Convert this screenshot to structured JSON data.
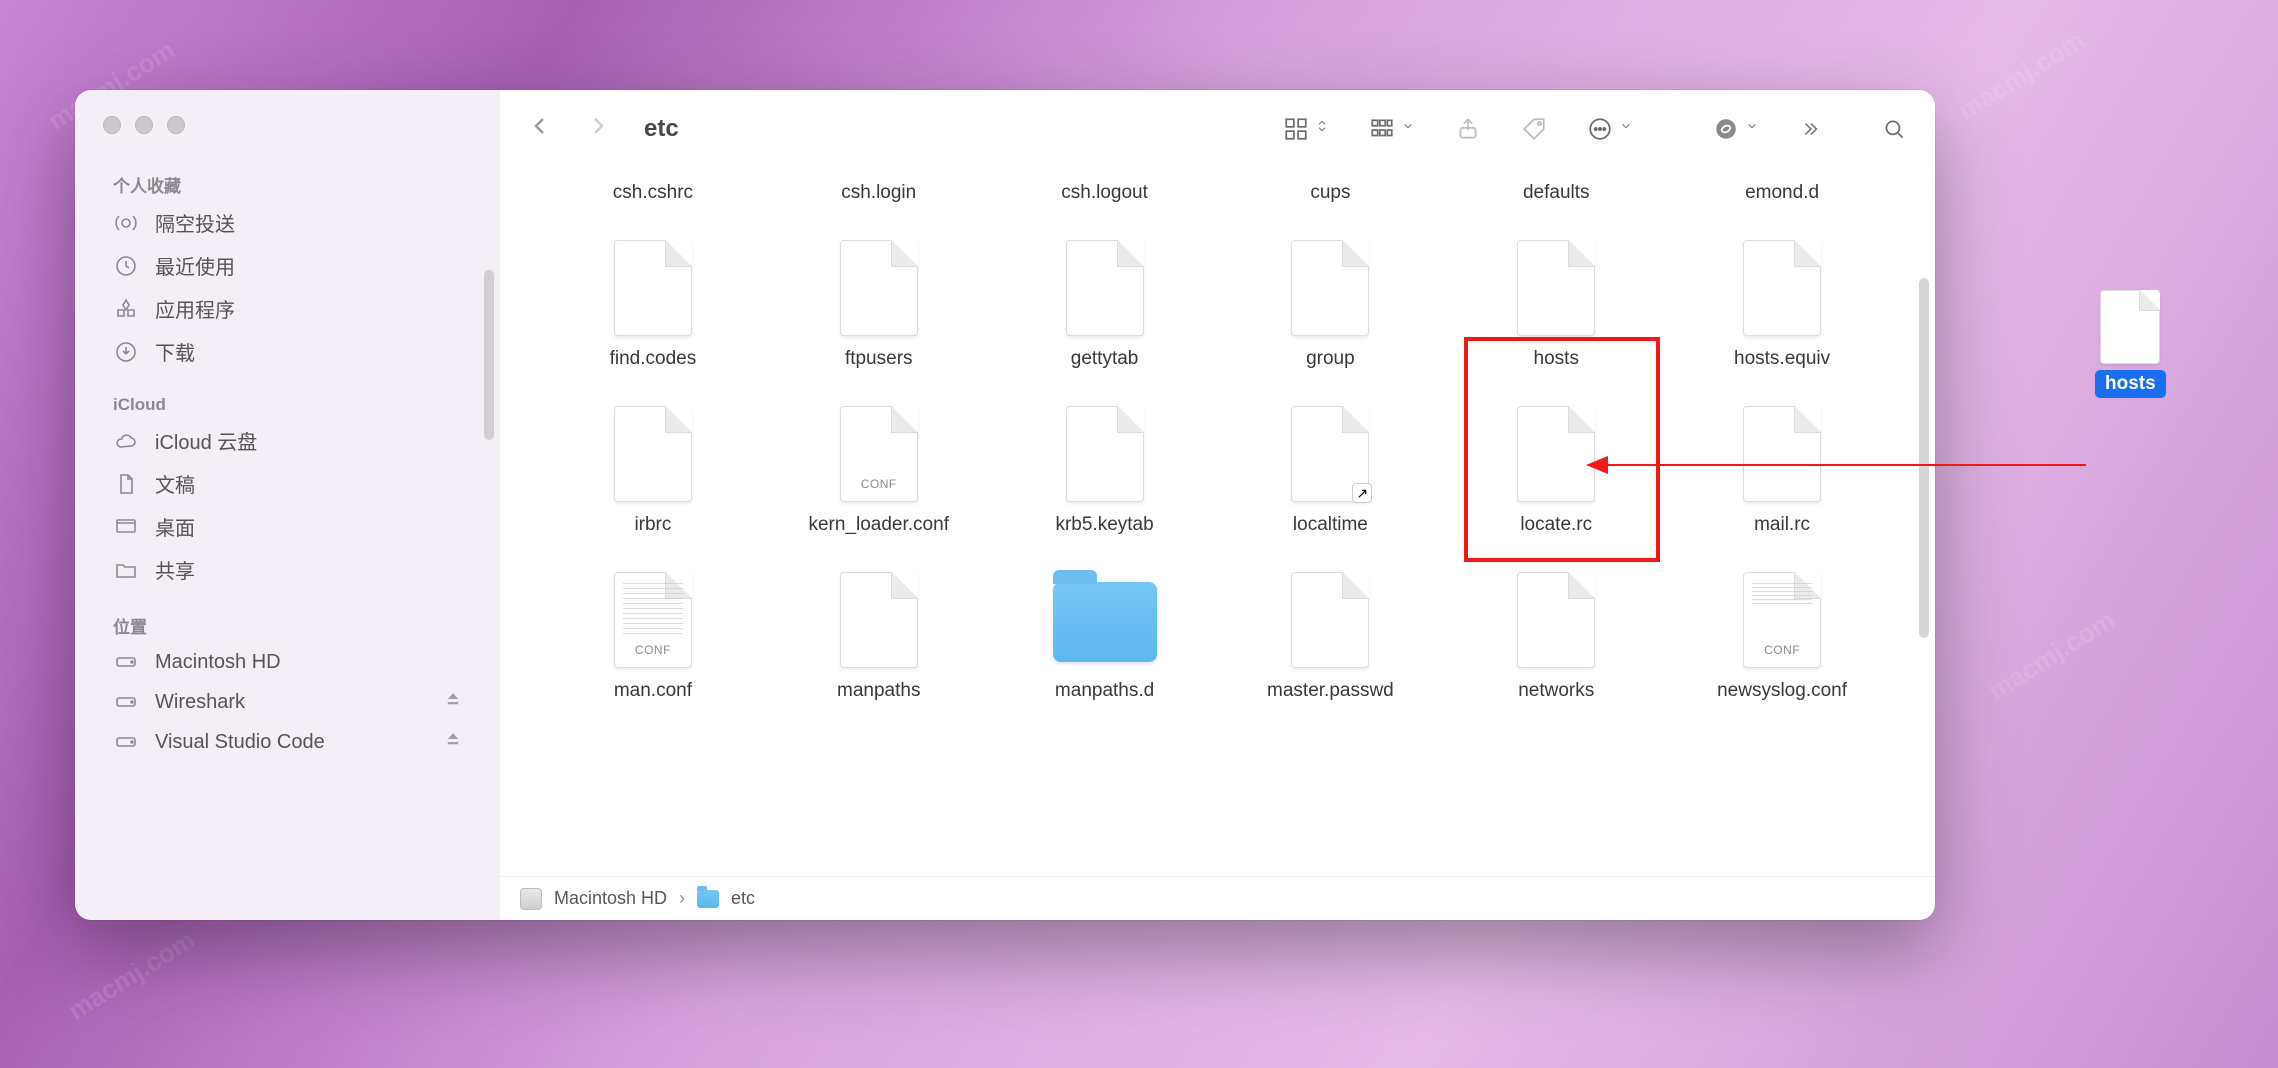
{
  "window": {
    "title": "etc"
  },
  "sidebar": {
    "sections": [
      {
        "heading": "个人收藏",
        "items": [
          {
            "label": "隔空投送",
            "icon": "airdrop"
          },
          {
            "label": "最近使用",
            "icon": "clock"
          },
          {
            "label": "应用程序",
            "icon": "apps"
          },
          {
            "label": "下载",
            "icon": "download"
          }
        ]
      },
      {
        "heading": "iCloud",
        "items": [
          {
            "label": "iCloud 云盘",
            "icon": "cloud"
          },
          {
            "label": "文稿",
            "icon": "doc"
          },
          {
            "label": "桌面",
            "icon": "desktop"
          },
          {
            "label": "共享",
            "icon": "shared"
          }
        ]
      },
      {
        "heading": "位置",
        "items": [
          {
            "label": "Macintosh HD",
            "icon": "disk"
          },
          {
            "label": "Wireshark",
            "icon": "disk",
            "ejectable": true
          },
          {
            "label": "Visual Studio Code",
            "icon": "disk",
            "ejectable": true
          }
        ]
      }
    ]
  },
  "files": {
    "row0": [
      {
        "name": "csh.cshrc",
        "type": "file"
      },
      {
        "name": "csh.login",
        "type": "file"
      },
      {
        "name": "csh.logout",
        "type": "file"
      },
      {
        "name": "cups",
        "type": "folder"
      },
      {
        "name": "defaults",
        "type": "folder"
      },
      {
        "name": "emond.d",
        "type": "folder"
      }
    ],
    "row1": [
      {
        "name": "find.codes",
        "type": "file"
      },
      {
        "name": "ftpusers",
        "type": "file"
      },
      {
        "name": "gettytab",
        "type": "file"
      },
      {
        "name": "group",
        "type": "file"
      },
      {
        "name": "hosts",
        "type": "file",
        "highlighted": true
      },
      {
        "name": "hosts.equiv",
        "type": "file"
      }
    ],
    "row2": [
      {
        "name": "irbrc",
        "type": "file"
      },
      {
        "name": "kern_loader.conf",
        "type": "file",
        "badge": "conf"
      },
      {
        "name": "krb5.keytab",
        "type": "file"
      },
      {
        "name": "localtime",
        "type": "file",
        "shortcut": true
      },
      {
        "name": "locate.rc",
        "type": "file"
      },
      {
        "name": "mail.rc",
        "type": "file"
      }
    ],
    "row3": [
      {
        "name": "man.conf",
        "type": "file",
        "badge": "manconf"
      },
      {
        "name": "manpaths",
        "type": "file"
      },
      {
        "name": "manpaths.d",
        "type": "folder"
      },
      {
        "name": "master.passwd",
        "type": "file"
      },
      {
        "name": "networks",
        "type": "file"
      },
      {
        "name": "newsyslog.conf",
        "type": "file",
        "badge": "newsys"
      }
    ]
  },
  "pathbar": {
    "segments": [
      "Macintosh HD",
      "etc"
    ]
  },
  "desktop_item": {
    "label": "hosts"
  },
  "watermark": "macmj.com"
}
